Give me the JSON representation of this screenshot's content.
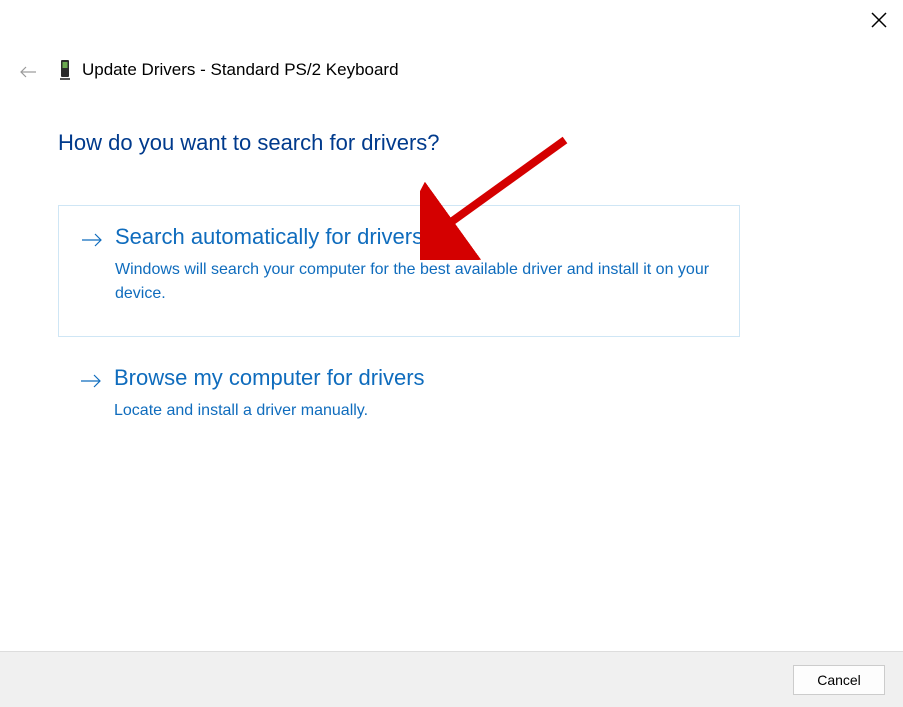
{
  "header": {
    "title": "Update Drivers - Standard PS/2 Keyboard"
  },
  "main": {
    "heading": "How do you want to search for drivers?"
  },
  "options": {
    "auto": {
      "title": "Search automatically for drivers",
      "description": "Windows will search your computer for the best available driver and install it on your device."
    },
    "browse": {
      "title": "Browse my computer for drivers",
      "description": "Locate and install a driver manually."
    }
  },
  "footer": {
    "cancel": "Cancel"
  }
}
